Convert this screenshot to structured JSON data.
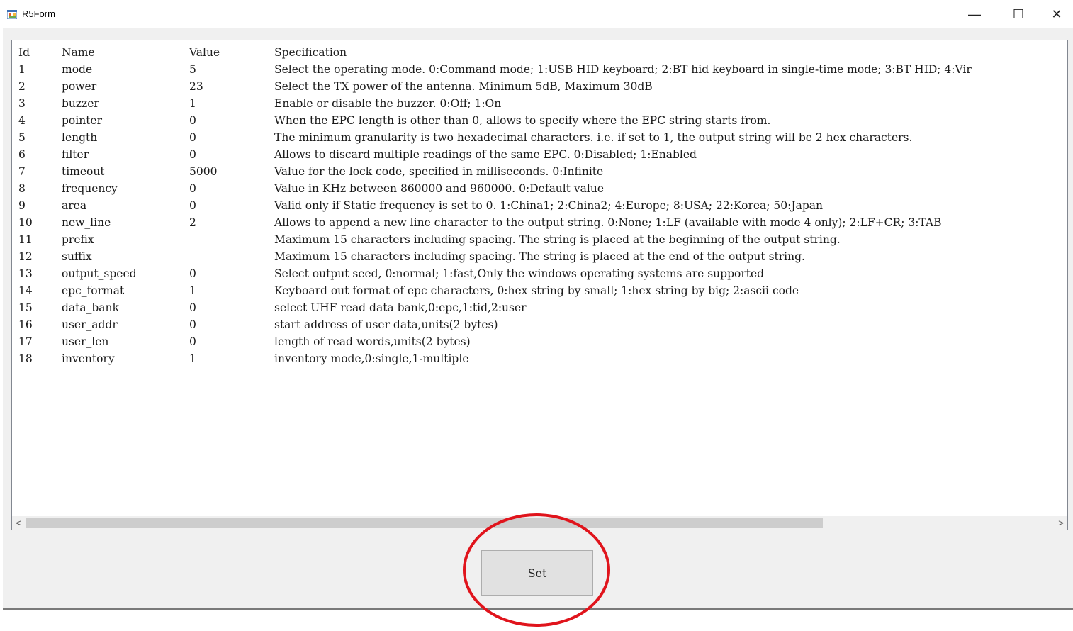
{
  "window": {
    "title": "R5Form",
    "icons": {
      "app": "app-form-icon",
      "minimize": "minimize-icon",
      "maximize": "maximize-icon",
      "close": "close-icon"
    },
    "controls": {
      "minimize": "—",
      "maximize": "☐",
      "close": "✕"
    }
  },
  "table": {
    "columns": [
      "Id",
      "Name",
      "Value",
      "Specification"
    ],
    "rows": [
      [
        "1",
        "mode",
        "5",
        "Select the operating mode. 0:Command mode; 1:USB HID keyboard; 2:BT hid keyboard in single-time mode; 3:BT HID; 4:Vir"
      ],
      [
        "2",
        "power",
        "23",
        "Select the TX power of the antenna. Minimum 5dB, Maximum 30dB"
      ],
      [
        "3",
        "buzzer",
        "1",
        "Enable or disable the buzzer. 0:Off; 1:On"
      ],
      [
        "4",
        "pointer",
        "0",
        "When the EPC length is other than 0, allows to specify where the EPC string starts from."
      ],
      [
        "5",
        "length",
        "0",
        "The minimum granularity is two hexadecimal characters. i.e. if set to 1, the output string will be 2 hex characters."
      ],
      [
        "6",
        "filter",
        "0",
        "Allows to discard multiple readings of the same EPC. 0:Disabled; 1:Enabled"
      ],
      [
        "7",
        "timeout",
        "5000",
        "Value for the lock code, specified in milliseconds. 0:Infinite"
      ],
      [
        "8",
        "frequency",
        "0",
        "Value in KHz between 860000 and 960000. 0:Default value"
      ],
      [
        "9",
        "area",
        "0",
        "Valid only if Static frequency is set to 0. 1:China1; 2:China2; 4:Europe; 8:USA; 22:Korea; 50:Japan"
      ],
      [
        "10",
        "new_line",
        "2",
        "Allows to append a new line character to the output string. 0:None; 1:LF (available with mode 4 only); 2:LF+CR; 3:TAB"
      ],
      [
        "11",
        "prefix",
        "",
        "Maximum 15 characters including spacing. The string is placed at the beginning of the output string."
      ],
      [
        "12",
        "suffix",
        "",
        "Maximum 15 characters including spacing. The string is placed at the end of the output string."
      ],
      [
        "13",
        "output_speed",
        "0",
        "Select output seed, 0:normal; 1:fast,Only the windows operating systems are supported"
      ],
      [
        "14",
        "epc_format",
        "1",
        "Keyboard out format of epc characters, 0:hex string by small; 1:hex string by big; 2:ascii code"
      ],
      [
        "15",
        "data_bank",
        "0",
        "select UHF read data bank,0:epc,1:tid,2:user"
      ],
      [
        "16",
        "user_addr",
        "0",
        "start address of user data,units(2 bytes)"
      ],
      [
        "17",
        "user_len",
        "0",
        "length of read words,units(2 bytes)"
      ],
      [
        "18",
        "inventory",
        "1",
        "inventory mode,0:single,1-multiple"
      ]
    ]
  },
  "scrollbar": {
    "left_arrow": "<",
    "right_arrow": ">",
    "left_icon": "chevron-left-icon",
    "right_icon": "chevron-right-icon"
  },
  "button": {
    "set_label": "Set"
  },
  "annotation": {
    "shape": "ellipse",
    "color": "#e0141c"
  }
}
